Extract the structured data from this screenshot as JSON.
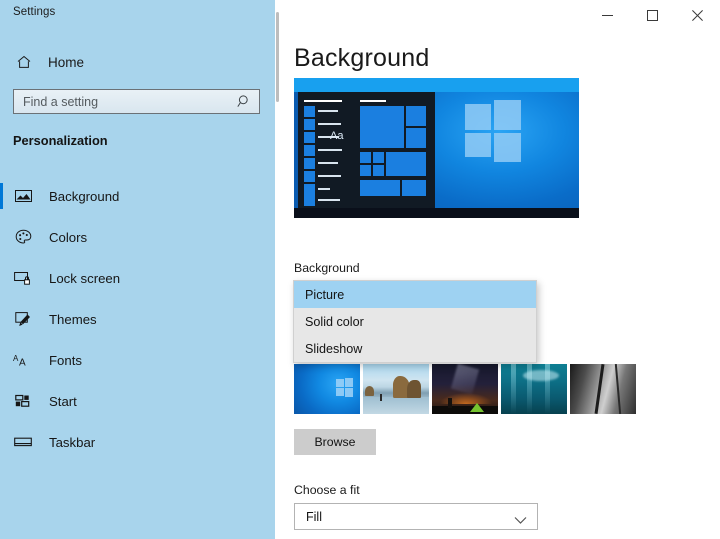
{
  "window": {
    "title": "Settings",
    "controls": [
      {
        "name": "minimize",
        "glyph": "minimize-icon"
      },
      {
        "name": "maximize",
        "glyph": "maximize-icon"
      },
      {
        "name": "close",
        "glyph": "close-icon"
      }
    ]
  },
  "sidebar": {
    "home_label": "Home",
    "home_icon": "home-icon",
    "search": {
      "placeholder": "Find a setting",
      "value": "",
      "icon": "search-icon"
    },
    "section_title": "Personalization",
    "items": [
      {
        "label": "Background",
        "icon": "image-icon",
        "selected": true
      },
      {
        "label": "Colors",
        "icon": "palette-icon",
        "selected": false
      },
      {
        "label": "Lock screen",
        "icon": "lock-screen-icon",
        "selected": false
      },
      {
        "label": "Themes",
        "icon": "brush-icon",
        "selected": false
      },
      {
        "label": "Fonts",
        "icon": "fonts-icon",
        "selected": false
      },
      {
        "label": "Start",
        "icon": "start-icon",
        "selected": false
      },
      {
        "label": "Taskbar",
        "icon": "taskbar-icon",
        "selected": false
      }
    ]
  },
  "main": {
    "page_title": "Background",
    "preview": {
      "name": "background-preview",
      "aa_text": "Aa"
    },
    "background_field": {
      "label": "Background",
      "selected_value": "Picture",
      "expanded": true,
      "options": [
        "Picture",
        "Solid color",
        "Slideshow"
      ]
    },
    "choose_picture": {
      "thumbnails": [
        {
          "name": "thumbnail-windows-hero"
        },
        {
          "name": "thumbnail-beach-sea-stack"
        },
        {
          "name": "thumbnail-night-camp"
        },
        {
          "name": "thumbnail-underwater"
        },
        {
          "name": "thumbnail-rock-face"
        }
      ],
      "browse_label": "Browse"
    },
    "fit_field": {
      "label": "Choose a fit",
      "selected_value": "Fill",
      "chevron_icon": "chevron-down-icon"
    }
  },
  "colors": {
    "sidebar_bg": "#a8d4ec",
    "accent": "#0078d7",
    "highlight": "#9ed2f2",
    "dropdown_bg": "#e7e7e7",
    "button_bg": "#cccccc"
  }
}
